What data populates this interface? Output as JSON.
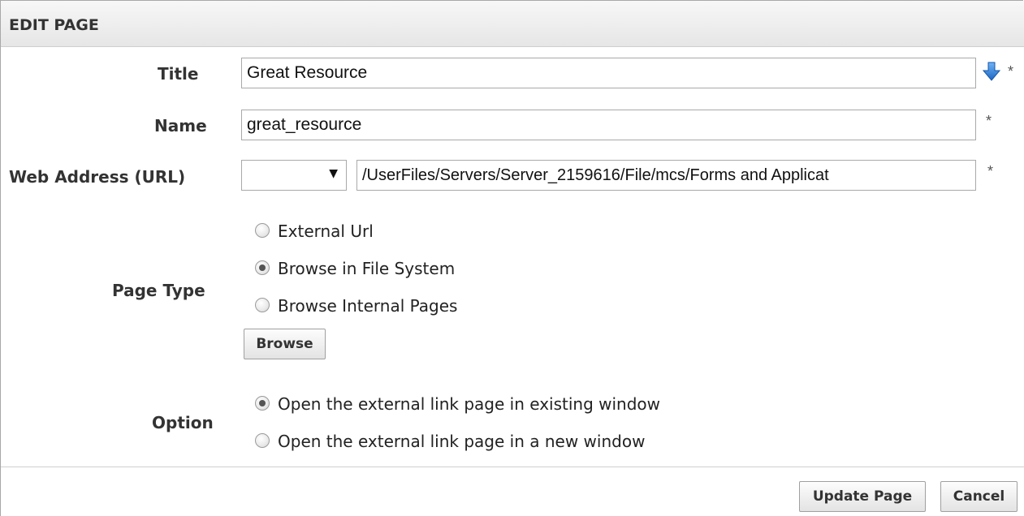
{
  "header": {
    "title": "EDIT PAGE"
  },
  "form": {
    "title": {
      "label": "Title",
      "value": "Great Resource",
      "required": "*"
    },
    "name": {
      "label": "Name",
      "value": "great_resource",
      "required": "*"
    },
    "url": {
      "label": "Web Address (URL)",
      "select_value": "",
      "value": "/UserFiles/Servers/Server_2159616/File/mcs/Forms and Applicat",
      "required": "*"
    },
    "page_type": {
      "label": "Page Type",
      "options": [
        {
          "label": "External Url",
          "checked": false
        },
        {
          "label": "Browse in File System",
          "checked": true
        },
        {
          "label": "Browse Internal Pages",
          "checked": false
        }
      ],
      "browse_label": "Browse"
    },
    "option": {
      "label": "Option",
      "options": [
        {
          "label": "Open the external link page in existing window",
          "checked": true
        },
        {
          "label": "Open the external link page in a new window",
          "checked": false
        }
      ]
    }
  },
  "footer": {
    "update_label": "Update Page",
    "cancel_label": "Cancel"
  },
  "colors": {
    "arrow_icon": "#2f7fd6",
    "header_bg": "#ececec",
    "border": "#a8a8a8"
  },
  "icons": {
    "title_action": "arrow-down-icon",
    "select_caret": "caret-down-icon"
  }
}
